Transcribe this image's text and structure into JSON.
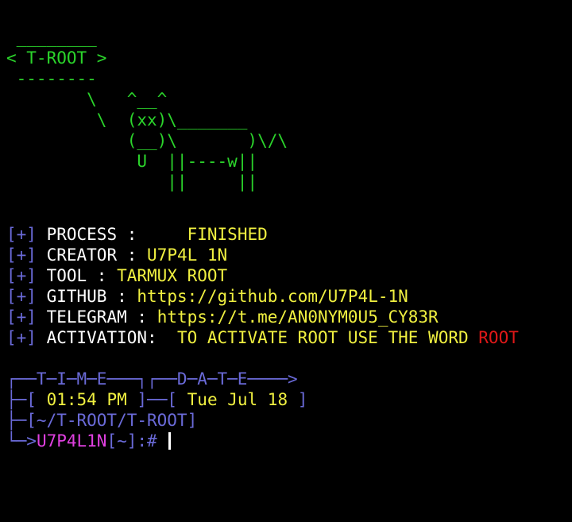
{
  "banner": {
    "ascii_art": " ________\n< T-ROOT >\n --------\n        \\   ^__^\n         \\  (xx)\\_______\n            (__)\\       )\\/\\\n             U  ||----w||\n                ||     ||"
  },
  "info": {
    "marker": "[+]",
    "rows": [
      {
        "label": "PROCESS :",
        "value": "FINISHED"
      },
      {
        "label": "CREATOR :",
        "value": "U7P4L 1N"
      },
      {
        "label": "TOOL :",
        "value": "TARMUX ROOT"
      },
      {
        "label": "GITHUB :",
        "value": "https://github.com/U7P4L-1N"
      },
      {
        "label": "TELEGRAM :",
        "value": "https://t.me/AN0NYM0U5_CY83R"
      },
      {
        "label": "ACTIVATION:",
        "value": "TO ACTIVATE ROOT USE THE WORD",
        "highlight": "ROOT"
      }
    ]
  },
  "prompt": {
    "header_line": "┌──T─I─M─E───┐┌──D─A─T─E────>",
    "time_open": "├─[",
    "time": "01:54 PM",
    "time_close": "]─",
    "date_open": "─[",
    "date": "Tue Jul 18",
    "date_close": "]",
    "path_line": "├─[~/T-ROOT/T-ROOT]",
    "input_prefix": "└─>",
    "user": "U7P4L1N",
    "cwd": "[~]:#"
  },
  "colors": {
    "background": "#000000",
    "ascii": "#2bd42b",
    "bracket": "#6a6ad8",
    "label": "#ffffff",
    "value": "#f0f040",
    "highlight": "#e01818",
    "user": "#e040e0"
  }
}
